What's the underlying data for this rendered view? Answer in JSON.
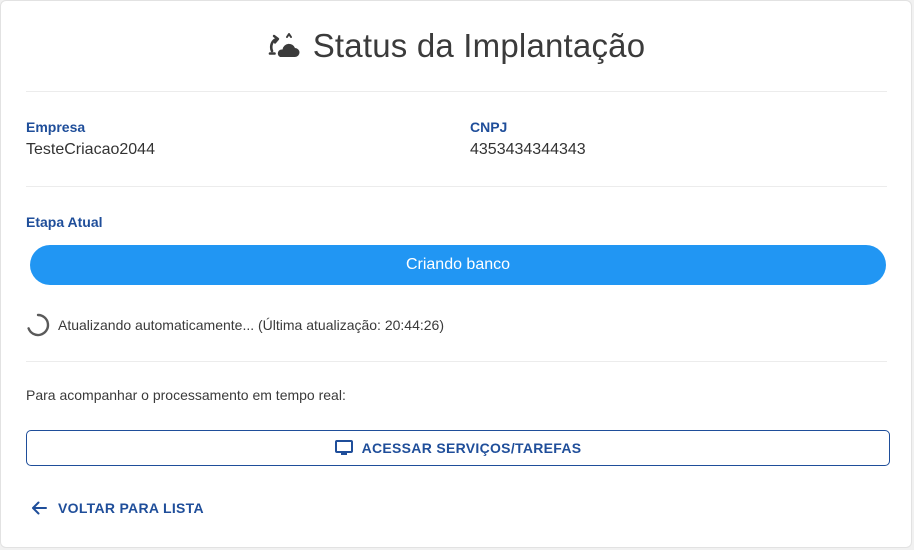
{
  "header": {
    "title": "Status da Implantação",
    "icon": "cloud-sync-icon"
  },
  "company": {
    "label": "Empresa",
    "value": "TesteCriacao2044"
  },
  "cnpj": {
    "label": "CNPJ",
    "value": "4353434344343"
  },
  "stage": {
    "label": "Etapa Atual",
    "value": "Criando banco",
    "color": "#2196f3"
  },
  "refresh": {
    "text": "Atualizando automaticamente... (Última atualização: 20:44:26)",
    "icon": "loading-spinner-icon"
  },
  "realtime": {
    "text": "Para acompanhar o processamento em tempo real:"
  },
  "actions": {
    "services_label": "ACESSAR SERVIÇOS/TAREFAS",
    "services_icon": "monitor-icon",
    "back_label": "VOLTAR PARA LISTA",
    "back_icon": "arrow-left-icon"
  },
  "colors": {
    "accent": "#1f4e9a",
    "primary": "#2196f3",
    "text": "#333333"
  }
}
